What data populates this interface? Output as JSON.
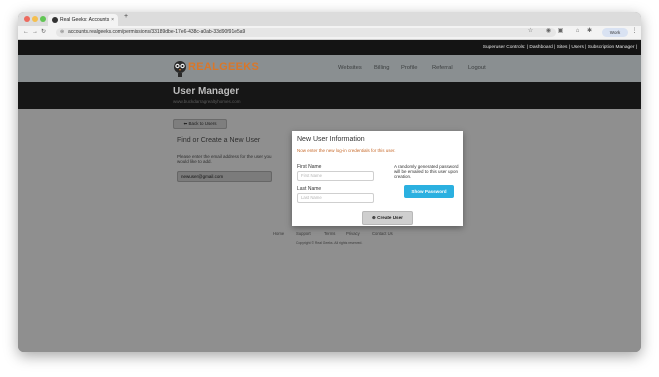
{
  "browser": {
    "tab_title": "Real Geeks: Accounts",
    "tab_close": "×",
    "new_tab": "+",
    "url": "accounts.realgeeks.com/permissions/33189dbe-17e6-438c-a0ab-33d90f91e5a9",
    "nav_back": "←",
    "nav_forward": "→",
    "nav_reload": "↻",
    "profile_label": "Work"
  },
  "superuser_bar": {
    "text": "Superuser Controls: | Dashboard | Sites | Users | Subscription Manager |"
  },
  "logo": {
    "text": "REALGEEKS"
  },
  "nav": {
    "items": [
      "Websites",
      "Billing",
      "Profile",
      "Referral",
      "Logout"
    ]
  },
  "banner": {
    "title": "User Manager",
    "email": "www.buckdarragrealtyhomes.com"
  },
  "main": {
    "back_button": "⬅ Back to Users",
    "find_title": "Find or Create a New User",
    "find_desc": "Please enter the email address for the user you would like to add.",
    "email_value": "newuser@gmail.com"
  },
  "modal": {
    "title": "New User Information",
    "subtitle": "Now enter the new log-in credentials for this user.",
    "first_name_label": "First Name",
    "first_name_placeholder": "First Name",
    "last_name_label": "Last Name",
    "last_name_placeholder": "Last Name",
    "note": "A randomly generated password will be emailed to this user upon creation.",
    "show_password": "Show Password",
    "create_user": "⊕ Create User"
  },
  "footer": {
    "links": [
      "Home",
      "Support",
      "Terms",
      "Privacy",
      "Contact Us"
    ],
    "copyright": "Copyright © Real Geeks. All rights reserved."
  },
  "colors": {
    "accent_orange": "#d9772a",
    "button_blue": "#2bb0e0",
    "dark_band": "#161616"
  }
}
